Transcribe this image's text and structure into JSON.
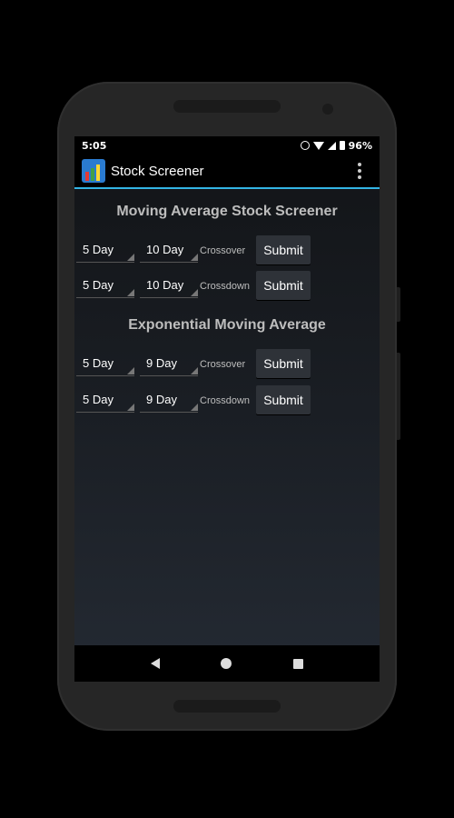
{
  "status": {
    "time": "5:05",
    "battery": "96%"
  },
  "app": {
    "title": "Stock Screener"
  },
  "icons": {
    "app": "stock-chart-icon",
    "overflow": "more-vert-icon"
  },
  "accent": "#33b5e5",
  "sections": [
    {
      "title": "Moving Average Stock Screener",
      "rows": [
        {
          "short": "5 Day",
          "long": "10 Day",
          "label": "Crossover",
          "submit": "Submit"
        },
        {
          "short": "5 Day",
          "long": "10 Day",
          "label": "Crossdown",
          "submit": "Submit"
        }
      ]
    },
    {
      "title": "Exponential Moving Average",
      "rows": [
        {
          "short": "5 Day",
          "long": "9 Day",
          "label": "Crossover",
          "submit": "Submit"
        },
        {
          "short": "5 Day",
          "long": "9 Day",
          "label": "Crossdown",
          "submit": "Submit"
        }
      ]
    }
  ]
}
